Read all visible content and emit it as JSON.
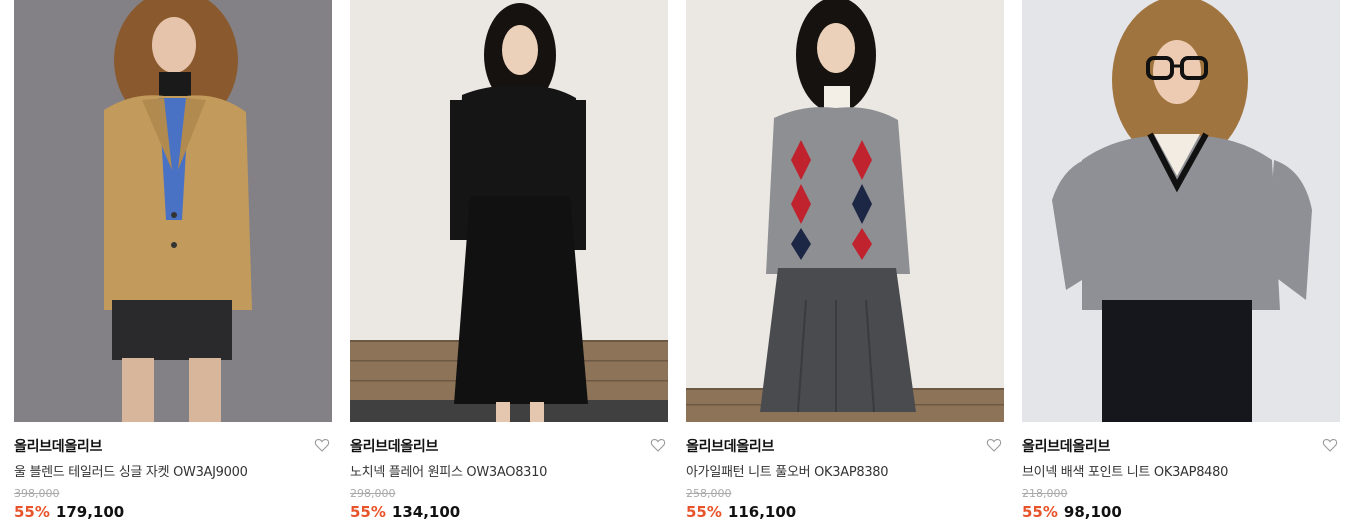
{
  "products": [
    {
      "brand": "올리브데올리브",
      "name": "울 블렌드 테일러드 싱글 자켓 OW3AJ9000",
      "original_price": "398,000",
      "discount": "55%",
      "sale_price": "179,100",
      "photo_desc": "camel-jacket-model-photo"
    },
    {
      "brand": "올리브데올리브",
      "name": "노치넥 플레어 원피스 OW3AO8310",
      "original_price": "298,000",
      "discount": "55%",
      "sale_price": "134,100",
      "photo_desc": "black-dress-model-photo"
    },
    {
      "brand": "올리브데올리브",
      "name": "아가일패턴 니트 풀오버 OK3AP8380",
      "original_price": "258,000",
      "discount": "55%",
      "sale_price": "116,100",
      "photo_desc": "argyle-knit-model-photo"
    },
    {
      "brand": "올리브데올리브",
      "name": "브이넥 배색 포인트 니트 OK3AP8480",
      "original_price": "218,000",
      "discount": "55%",
      "sale_price": "98,100",
      "photo_desc": "vneck-knit-model-photo"
    }
  ],
  "colors": {
    "discount": "#e8542a",
    "brand_text": "#111111",
    "original_price": "#aaaaaa"
  },
  "icons": {
    "wishlist": "heart-outline-icon"
  }
}
